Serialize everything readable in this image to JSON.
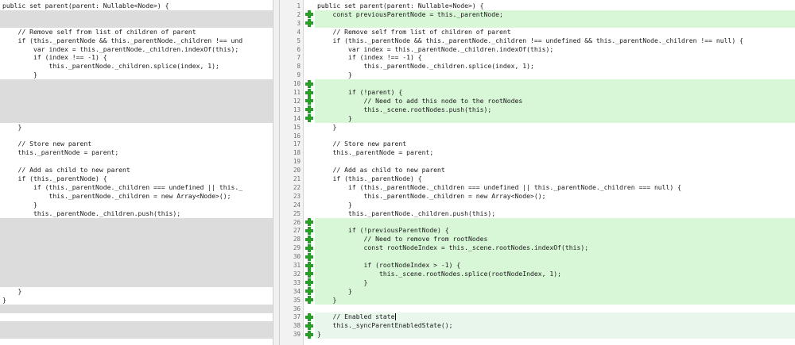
{
  "left_pane": {
    "lines": [
      {
        "text": "public set parent(parent: Nullable<Node>) {",
        "bg": "none"
      },
      {
        "text": "",
        "bg": "gray"
      },
      {
        "text": "",
        "bg": "gray"
      },
      {
        "text": "    // Remove self from list of children of parent",
        "bg": "none"
      },
      {
        "text": "    if (this._parentNode && this._parentNode._children !== und",
        "bg": "none"
      },
      {
        "text": "        var index = this._parentNode._children.indexOf(this);",
        "bg": "none"
      },
      {
        "text": "        if (index !== -1) {",
        "bg": "none"
      },
      {
        "text": "            this._parentNode._children.splice(index, 1);",
        "bg": "none"
      },
      {
        "text": "        }",
        "bg": "none"
      },
      {
        "text": "",
        "bg": "gray"
      },
      {
        "text": "",
        "bg": "gray"
      },
      {
        "text": "",
        "bg": "gray"
      },
      {
        "text": "",
        "bg": "gray"
      },
      {
        "text": "",
        "bg": "gray"
      },
      {
        "text": "    }",
        "bg": "none"
      },
      {
        "text": "",
        "bg": "none"
      },
      {
        "text": "    // Store new parent",
        "bg": "none"
      },
      {
        "text": "    this._parentNode = parent;",
        "bg": "none"
      },
      {
        "text": "",
        "bg": "none"
      },
      {
        "text": "    // Add as child to new parent",
        "bg": "none"
      },
      {
        "text": "    if (this._parentNode) {",
        "bg": "none"
      },
      {
        "text": "        if (this._parentNode._children === undefined || this._",
        "bg": "none"
      },
      {
        "text": "            this._parentNode._children = new Array<Node>();",
        "bg": "none"
      },
      {
        "text": "        }",
        "bg": "none"
      },
      {
        "text": "        this._parentNode._children.push(this);",
        "bg": "none"
      },
      {
        "text": "",
        "bg": "gray"
      },
      {
        "text": "",
        "bg": "gray"
      },
      {
        "text": "",
        "bg": "gray"
      },
      {
        "text": "",
        "bg": "gray"
      },
      {
        "text": "",
        "bg": "gray"
      },
      {
        "text": "",
        "bg": "gray"
      },
      {
        "text": "",
        "bg": "gray"
      },
      {
        "text": "",
        "bg": "gray"
      },
      {
        "text": "    }",
        "bg": "none"
      },
      {
        "text": "}",
        "bg": "none"
      },
      {
        "text": "",
        "bg": "gray"
      },
      {
        "text": "",
        "bg": "none"
      },
      {
        "text": "",
        "bg": "gray"
      },
      {
        "text": "",
        "bg": "gray"
      },
      {
        "text": "",
        "bg": "none"
      }
    ]
  },
  "right_pane": {
    "lines": [
      {
        "num": "1",
        "text": "public set parent(parent: Nullable<Node>) {",
        "bg": "none",
        "added": false
      },
      {
        "num": "2",
        "text": "    const previousParentNode = this._parentNode;",
        "bg": "green",
        "added": true
      },
      {
        "num": "3",
        "text": "",
        "bg": "green",
        "added": true
      },
      {
        "num": "4",
        "text": "    // Remove self from list of children of parent",
        "bg": "none",
        "added": false
      },
      {
        "num": "5",
        "text": "    if (this._parentNode && this._parentNode._children !== undefined && this._parentNode._children !== null) {",
        "bg": "none",
        "added": false
      },
      {
        "num": "6",
        "text": "        var index = this._parentNode._children.indexOf(this);",
        "bg": "none",
        "added": false
      },
      {
        "num": "7",
        "text": "        if (index !== -1) {",
        "bg": "none",
        "added": false
      },
      {
        "num": "8",
        "text": "            this._parentNode._children.splice(index, 1);",
        "bg": "none",
        "added": false
      },
      {
        "num": "9",
        "text": "        }",
        "bg": "none",
        "added": false
      },
      {
        "num": "10",
        "text": "",
        "bg": "green",
        "added": true
      },
      {
        "num": "11",
        "text": "        if (!parent) {",
        "bg": "green",
        "added": true
      },
      {
        "num": "12",
        "text": "            // Need to add this node to the rootNodes",
        "bg": "green",
        "added": true
      },
      {
        "num": "13",
        "text": "            this._scene.rootNodes.push(this);",
        "bg": "green",
        "added": true
      },
      {
        "num": "14",
        "text": "        }",
        "bg": "green",
        "added": true
      },
      {
        "num": "15",
        "text": "    }",
        "bg": "none",
        "added": false
      },
      {
        "num": "16",
        "text": "",
        "bg": "none",
        "added": false
      },
      {
        "num": "17",
        "text": "    // Store new parent",
        "bg": "none",
        "added": false
      },
      {
        "num": "18",
        "text": "    this._parentNode = parent;",
        "bg": "none",
        "added": false
      },
      {
        "num": "19",
        "text": "",
        "bg": "none",
        "added": false
      },
      {
        "num": "20",
        "text": "    // Add as child to new parent",
        "bg": "none",
        "added": false
      },
      {
        "num": "21",
        "text": "    if (this._parentNode) {",
        "bg": "none",
        "added": false
      },
      {
        "num": "22",
        "text": "        if (this._parentNode._children === undefined || this._parentNode._children === null) {",
        "bg": "none",
        "added": false
      },
      {
        "num": "23",
        "text": "            this._parentNode._children = new Array<Node>();",
        "bg": "none",
        "added": false
      },
      {
        "num": "24",
        "text": "        }",
        "bg": "none",
        "added": false
      },
      {
        "num": "25",
        "text": "        this._parentNode._children.push(this);",
        "bg": "none",
        "added": false
      },
      {
        "num": "26",
        "text": "",
        "bg": "green",
        "added": true
      },
      {
        "num": "27",
        "text": "        if (!previousParentNode) {",
        "bg": "green",
        "added": true
      },
      {
        "num": "28",
        "text": "            // Need to remove from rootNodes",
        "bg": "green",
        "added": true
      },
      {
        "num": "29",
        "text": "            const rootNodeIndex = this._scene.rootNodes.indexOf(this);",
        "bg": "green",
        "added": true
      },
      {
        "num": "30",
        "text": "",
        "bg": "green",
        "added": true
      },
      {
        "num": "31",
        "text": "            if (rootNodeIndex > -1) {",
        "bg": "green",
        "added": true
      },
      {
        "num": "32",
        "text": "                this._scene.rootNodes.splice(rootNodeIndex, 1);",
        "bg": "green",
        "added": true
      },
      {
        "num": "33",
        "text": "            }",
        "bg": "green",
        "added": true
      },
      {
        "num": "34",
        "text": "        }",
        "bg": "green",
        "added": true
      },
      {
        "num": "35",
        "text": "    }",
        "bg": "green",
        "added": true
      },
      {
        "num": "36",
        "text": "",
        "bg": "none",
        "added": false
      },
      {
        "num": "37",
        "text": "    // Enabled state",
        "bg": "hl",
        "added": true,
        "caret": true
      },
      {
        "num": "38",
        "text": "    this._syncParentEnabledState();",
        "bg": "hl",
        "added": true
      },
      {
        "num": "39",
        "text": "}",
        "bg": "hl",
        "added": true
      },
      {
        "num": "",
        "text": "",
        "bg": "none",
        "added": false
      }
    ]
  },
  "colors": {
    "added_bg": "#d7f7d7",
    "placeholder_bg": "#dcdcdc",
    "current_bg": "#e8f6ec",
    "plus_icon": "#2a9c2a"
  }
}
